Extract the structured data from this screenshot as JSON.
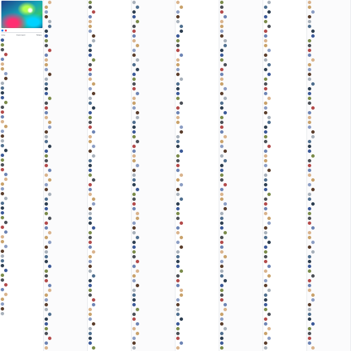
{
  "post": {
    "text_lines": [],
    "actions": [
      "Like",
      "Comment",
      "Share"
    ]
  },
  "comment_names": [],
  "comment_texts": [],
  "meta": "",
  "colors": {
    "link": "#385898",
    "meta": "#90949c",
    "accent": "#1877f2",
    "highlight": "#d93025"
  }
}
